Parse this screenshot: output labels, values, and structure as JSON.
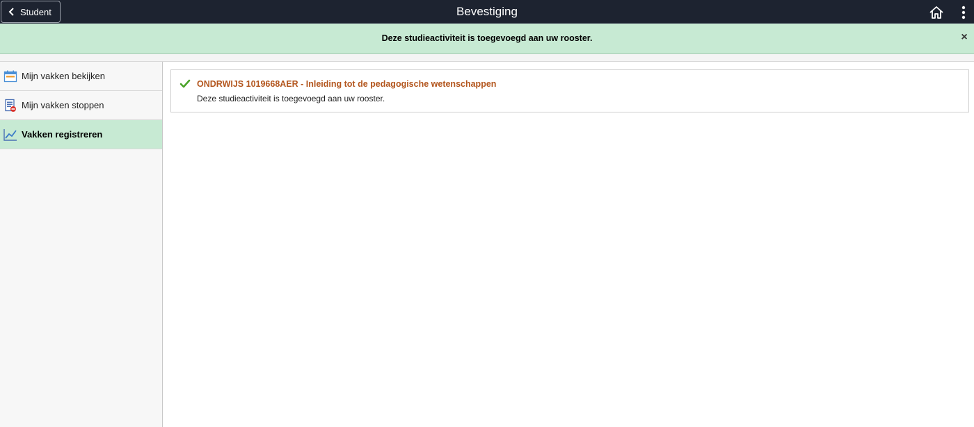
{
  "header": {
    "back_label": "Student",
    "title": "Bevestiging"
  },
  "banner": {
    "message": "Deze studieactiviteit is toegevoegd aan uw rooster.",
    "close_glyph": "×"
  },
  "sidebar": {
    "items": [
      {
        "label": "Mijn vakken bekijken",
        "icon": "calendar-icon",
        "active": false
      },
      {
        "label": "Mijn vakken stoppen",
        "icon": "drop-course-icon",
        "active": false
      },
      {
        "label": "Vakken registreren",
        "icon": "trend-chart-icon",
        "active": true
      }
    ]
  },
  "main": {
    "result": {
      "course": "ONDRWIJS 1019668AER - Inleiding tot de pedagogische wetenschappen",
      "message": "Deze studieactiviteit is toegevoegd aan uw rooster.",
      "status_icon": "checkmark-icon"
    }
  },
  "colors": {
    "header_bg": "#1d2330",
    "banner_bg": "#c7ead3",
    "active_item_bg": "#c7ead3",
    "course_title": "#b3561e",
    "check_green": "#4aa329"
  }
}
